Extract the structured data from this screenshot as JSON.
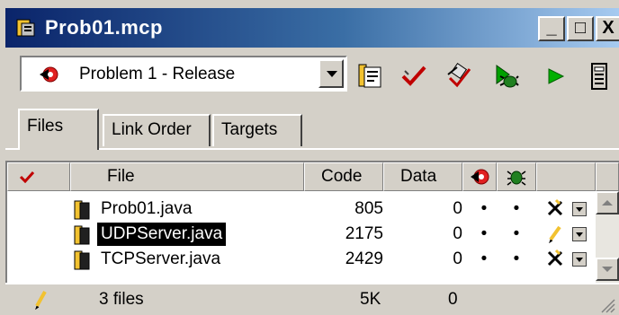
{
  "window": {
    "title": "Prob01.mcp",
    "controls": {
      "minimize": "_",
      "maximize": "□",
      "close": "X"
    }
  },
  "toolbar": {
    "target": "Problem 1 - Release",
    "icons": [
      "settings-icon",
      "check-icon",
      "compile-icon",
      "debug-icon",
      "run-icon",
      "device-icon"
    ]
  },
  "tabs": [
    {
      "label": "Files",
      "active": true
    },
    {
      "label": "Link Order",
      "active": false
    },
    {
      "label": "Targets",
      "active": false
    }
  ],
  "table": {
    "headers": {
      "file": "File",
      "code": "Code",
      "data": "Data"
    },
    "rows": [
      {
        "file": "Prob01.java",
        "code": "805",
        "data": "0",
        "debug": "•",
        "target": "•",
        "status": "excluded"
      },
      {
        "file": "UDPServer.java",
        "code": "2175",
        "data": "0",
        "debug": "•",
        "target": "•",
        "status": "modified",
        "selected": true
      },
      {
        "file": "TCPServer.java",
        "code": "2429",
        "data": "0",
        "debug": "•",
        "target": "•",
        "status": "excluded"
      }
    ]
  },
  "status": {
    "files": "3 files",
    "code": "5K",
    "data": "0"
  },
  "colors": {
    "title_start": "#0a246a",
    "title_end": "#a6caf0",
    "face": "#d4d0c8",
    "selection": "#000000"
  }
}
